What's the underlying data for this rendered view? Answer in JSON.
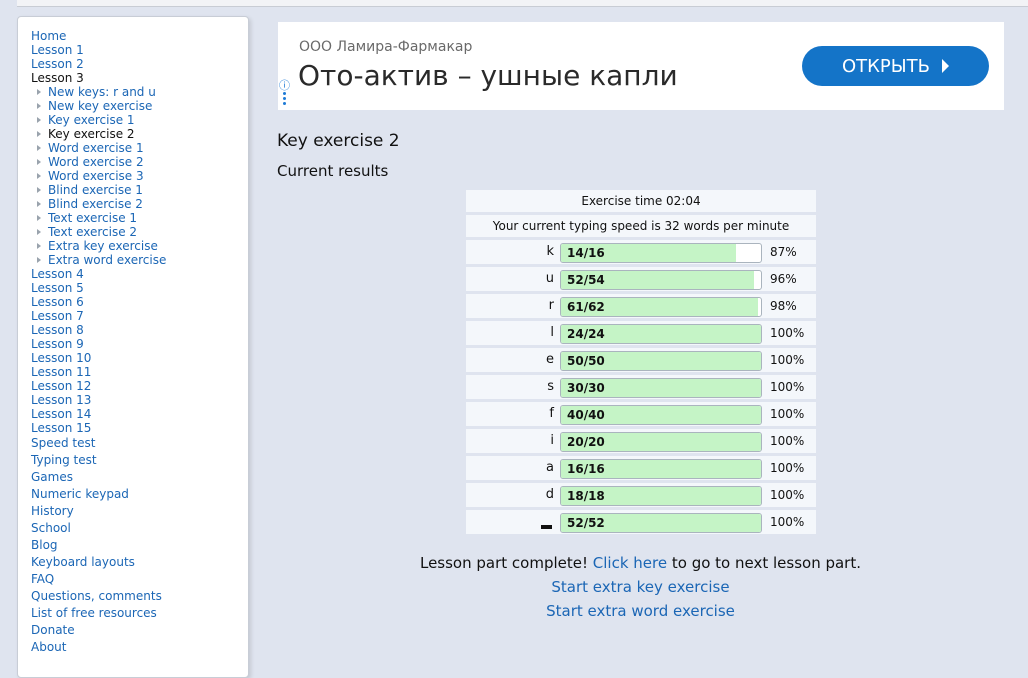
{
  "sidebar": {
    "top_items": [
      "Home",
      "Lesson 1",
      "Lesson 2"
    ],
    "current_lesson": "Lesson 3",
    "sub_items": [
      {
        "label": "New keys: r and u",
        "current": false
      },
      {
        "label": "New key exercise",
        "current": false
      },
      {
        "label": "Key exercise 1",
        "current": false
      },
      {
        "label": "Key exercise 2",
        "current": true
      },
      {
        "label": "Word exercise 1",
        "current": false
      },
      {
        "label": "Word exercise 2",
        "current": false
      },
      {
        "label": "Word exercise 3",
        "current": false
      },
      {
        "label": "Blind exercise 1",
        "current": false
      },
      {
        "label": "Blind exercise 2",
        "current": false
      },
      {
        "label": "Text exercise 1",
        "current": false
      },
      {
        "label": "Text exercise 2",
        "current": false
      },
      {
        "label": "Extra key exercise",
        "current": false
      },
      {
        "label": "Extra word exercise",
        "current": false
      }
    ],
    "lessons_after": [
      "Lesson 4",
      "Lesson 5",
      "Lesson 6",
      "Lesson 7",
      "Lesson 8",
      "Lesson 9",
      "Lesson 10",
      "Lesson 11",
      "Lesson 12",
      "Lesson 13",
      "Lesson 14",
      "Lesson 15"
    ],
    "big_items": [
      "Speed test",
      "Typing test",
      "Games",
      "Numeric keypad",
      "History",
      "School",
      "Blog",
      "Keyboard layouts",
      "FAQ",
      "Questions, comments",
      "List of free resources",
      "Donate",
      "About"
    ]
  },
  "ad": {
    "advertiser": "ООО Ламира-Фармакар",
    "title": "Ото-актив – ушные капли",
    "button_label": "ОТКРЫТЬ",
    "info_icon": "info-icon",
    "button_color": "#1474c8"
  },
  "page": {
    "title": "Key exercise 2",
    "subtitle": "Current results"
  },
  "results": {
    "exercise_time": "Exercise time 02:04",
    "speed_text": "Your current typing speed is 32 words per minute",
    "rows": [
      {
        "key": "k",
        "count": "14/16",
        "fraction": 0.875,
        "pct": "87%"
      },
      {
        "key": "u",
        "count": "52/54",
        "fraction": 0.963,
        "pct": "96%"
      },
      {
        "key": "r",
        "count": "61/62",
        "fraction": 0.984,
        "pct": "98%"
      },
      {
        "key": "l",
        "count": "24/24",
        "fraction": 1.0,
        "pct": "100%"
      },
      {
        "key": "e",
        "count": "50/50",
        "fraction": 1.0,
        "pct": "100%"
      },
      {
        "key": "s",
        "count": "30/30",
        "fraction": 1.0,
        "pct": "100%"
      },
      {
        "key": "f",
        "count": "40/40",
        "fraction": 1.0,
        "pct": "100%"
      },
      {
        "key": "i",
        "count": "20/20",
        "fraction": 1.0,
        "pct": "100%"
      },
      {
        "key": "a",
        "count": "16/16",
        "fraction": 1.0,
        "pct": "100%"
      },
      {
        "key": "d",
        "count": "18/18",
        "fraction": 1.0,
        "pct": "100%"
      },
      {
        "key": "space",
        "count": "52/52",
        "fraction": 1.0,
        "pct": "100%"
      }
    ],
    "bar_fill_color": "#c5f4c6"
  },
  "completion": {
    "prefix": "Lesson part complete!",
    "link_label": "Click here",
    "suffix": "to go to next lesson part.",
    "extra_key_link": "Start extra key exercise",
    "extra_word_link": "Start extra word exercise"
  }
}
